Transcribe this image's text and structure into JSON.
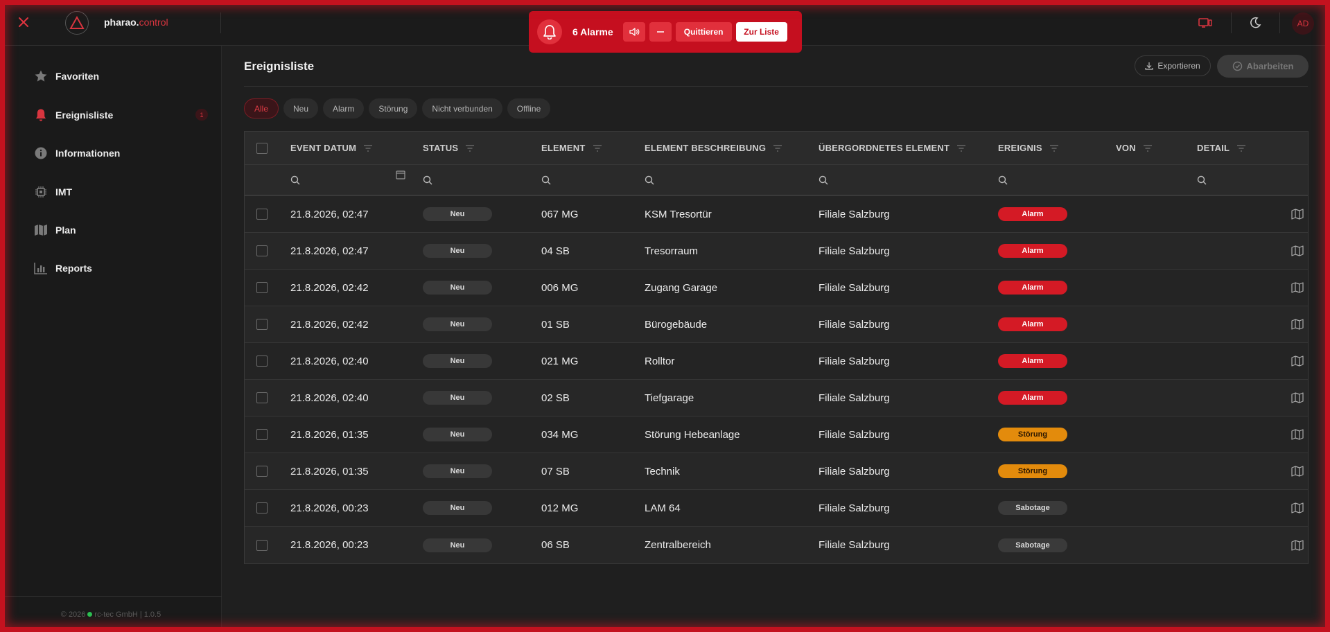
{
  "app": {
    "brand_name": "pharao.",
    "brand_accent": "control",
    "user_initials": "AD"
  },
  "alarm_banner": {
    "count_label": "6 Alarme",
    "acknowledge_label": "Quittieren",
    "to_list_label": "Zur Liste"
  },
  "sidebar": {
    "items": [
      {
        "label": "Favoriten",
        "icon": "star-icon"
      },
      {
        "label": "Ereignisliste",
        "icon": "bell-icon",
        "badge": "1"
      },
      {
        "label": "Informationen",
        "icon": "info-icon"
      },
      {
        "label": "IMT",
        "icon": "chip-icon"
      },
      {
        "label": "Plan",
        "icon": "map-icon"
      },
      {
        "label": "Reports",
        "icon": "chart-icon"
      }
    ],
    "footer_left": "© 2026",
    "footer_right": "rc-tec GmbH | 1.0.5"
  },
  "main": {
    "title": "Ereignisliste",
    "export_label": "Exportieren",
    "process_label": "Abarbeiten",
    "filter_chips": [
      "Alle",
      "Neu",
      "Alarm",
      "Störung",
      "Nicht verbunden",
      "Offline"
    ],
    "active_chip": "Alle"
  },
  "table": {
    "columns": [
      "EVENT DATUM",
      "STATUS",
      "ELEMENT",
      "ELEMENT BESCHREIBUNG",
      "ÜBERGORDNETES ELEMENT",
      "EREIGNIS",
      "VON",
      "DETAIL"
    ],
    "rows": [
      {
        "date": "21.8.2026, 02:47",
        "status": "Neu",
        "element": "067 MG",
        "description": "KSM Tresortür",
        "parent": "Filiale Salzburg",
        "event": "Alarm",
        "event_type": "alarm",
        "by": ""
      },
      {
        "date": "21.8.2026, 02:47",
        "status": "Neu",
        "element": "04 SB",
        "description": "Tresorraum",
        "parent": "Filiale Salzburg",
        "event": "Alarm",
        "event_type": "alarm",
        "by": ""
      },
      {
        "date": "21.8.2026, 02:42",
        "status": "Neu",
        "element": "006 MG",
        "description": "Zugang Garage",
        "parent": "Filiale Salzburg",
        "event": "Alarm",
        "event_type": "alarm",
        "by": ""
      },
      {
        "date": "21.8.2026, 02:42",
        "status": "Neu",
        "element": "01 SB",
        "description": "Bürogebäude",
        "parent": "Filiale Salzburg",
        "event": "Alarm",
        "event_type": "alarm",
        "by": ""
      },
      {
        "date": "21.8.2026, 02:40",
        "status": "Neu",
        "element": "021 MG",
        "description": "Rolltor",
        "parent": "Filiale Salzburg",
        "event": "Alarm",
        "event_type": "alarm",
        "by": ""
      },
      {
        "date": "21.8.2026, 02:40",
        "status": "Neu",
        "element": "02 SB",
        "description": "Tiefgarage",
        "parent": "Filiale Salzburg",
        "event": "Alarm",
        "event_type": "alarm",
        "by": ""
      },
      {
        "date": "21.8.2026, 01:35",
        "status": "Neu",
        "element": "034 MG",
        "description": "Störung Hebeanlage",
        "parent": "Filiale Salzburg",
        "event": "Störung",
        "event_type": "stoerung",
        "by": ""
      },
      {
        "date": "21.8.2026, 01:35",
        "status": "Neu",
        "element": "07 SB",
        "description": "Technik",
        "parent": "Filiale Salzburg",
        "event": "Störung",
        "event_type": "stoerung",
        "by": ""
      },
      {
        "date": "21.8.2026, 00:23",
        "status": "Neu",
        "element": "012 MG",
        "description": "LAM 64",
        "parent": "Filiale Salzburg",
        "event": "Sabotage",
        "event_type": "sabotage",
        "by": ""
      },
      {
        "date": "21.8.2026, 00:23",
        "status": "Neu",
        "element": "06 SB",
        "description": "Zentralbereich",
        "parent": "Filiale Salzburg",
        "event": "Sabotage",
        "event_type": "sabotage",
        "by": ""
      }
    ]
  },
  "colors": {
    "accent": "#d8353f",
    "alarm": "#d41a25",
    "stoerung": "#e38b0c",
    "background": "#1f1f1f"
  }
}
